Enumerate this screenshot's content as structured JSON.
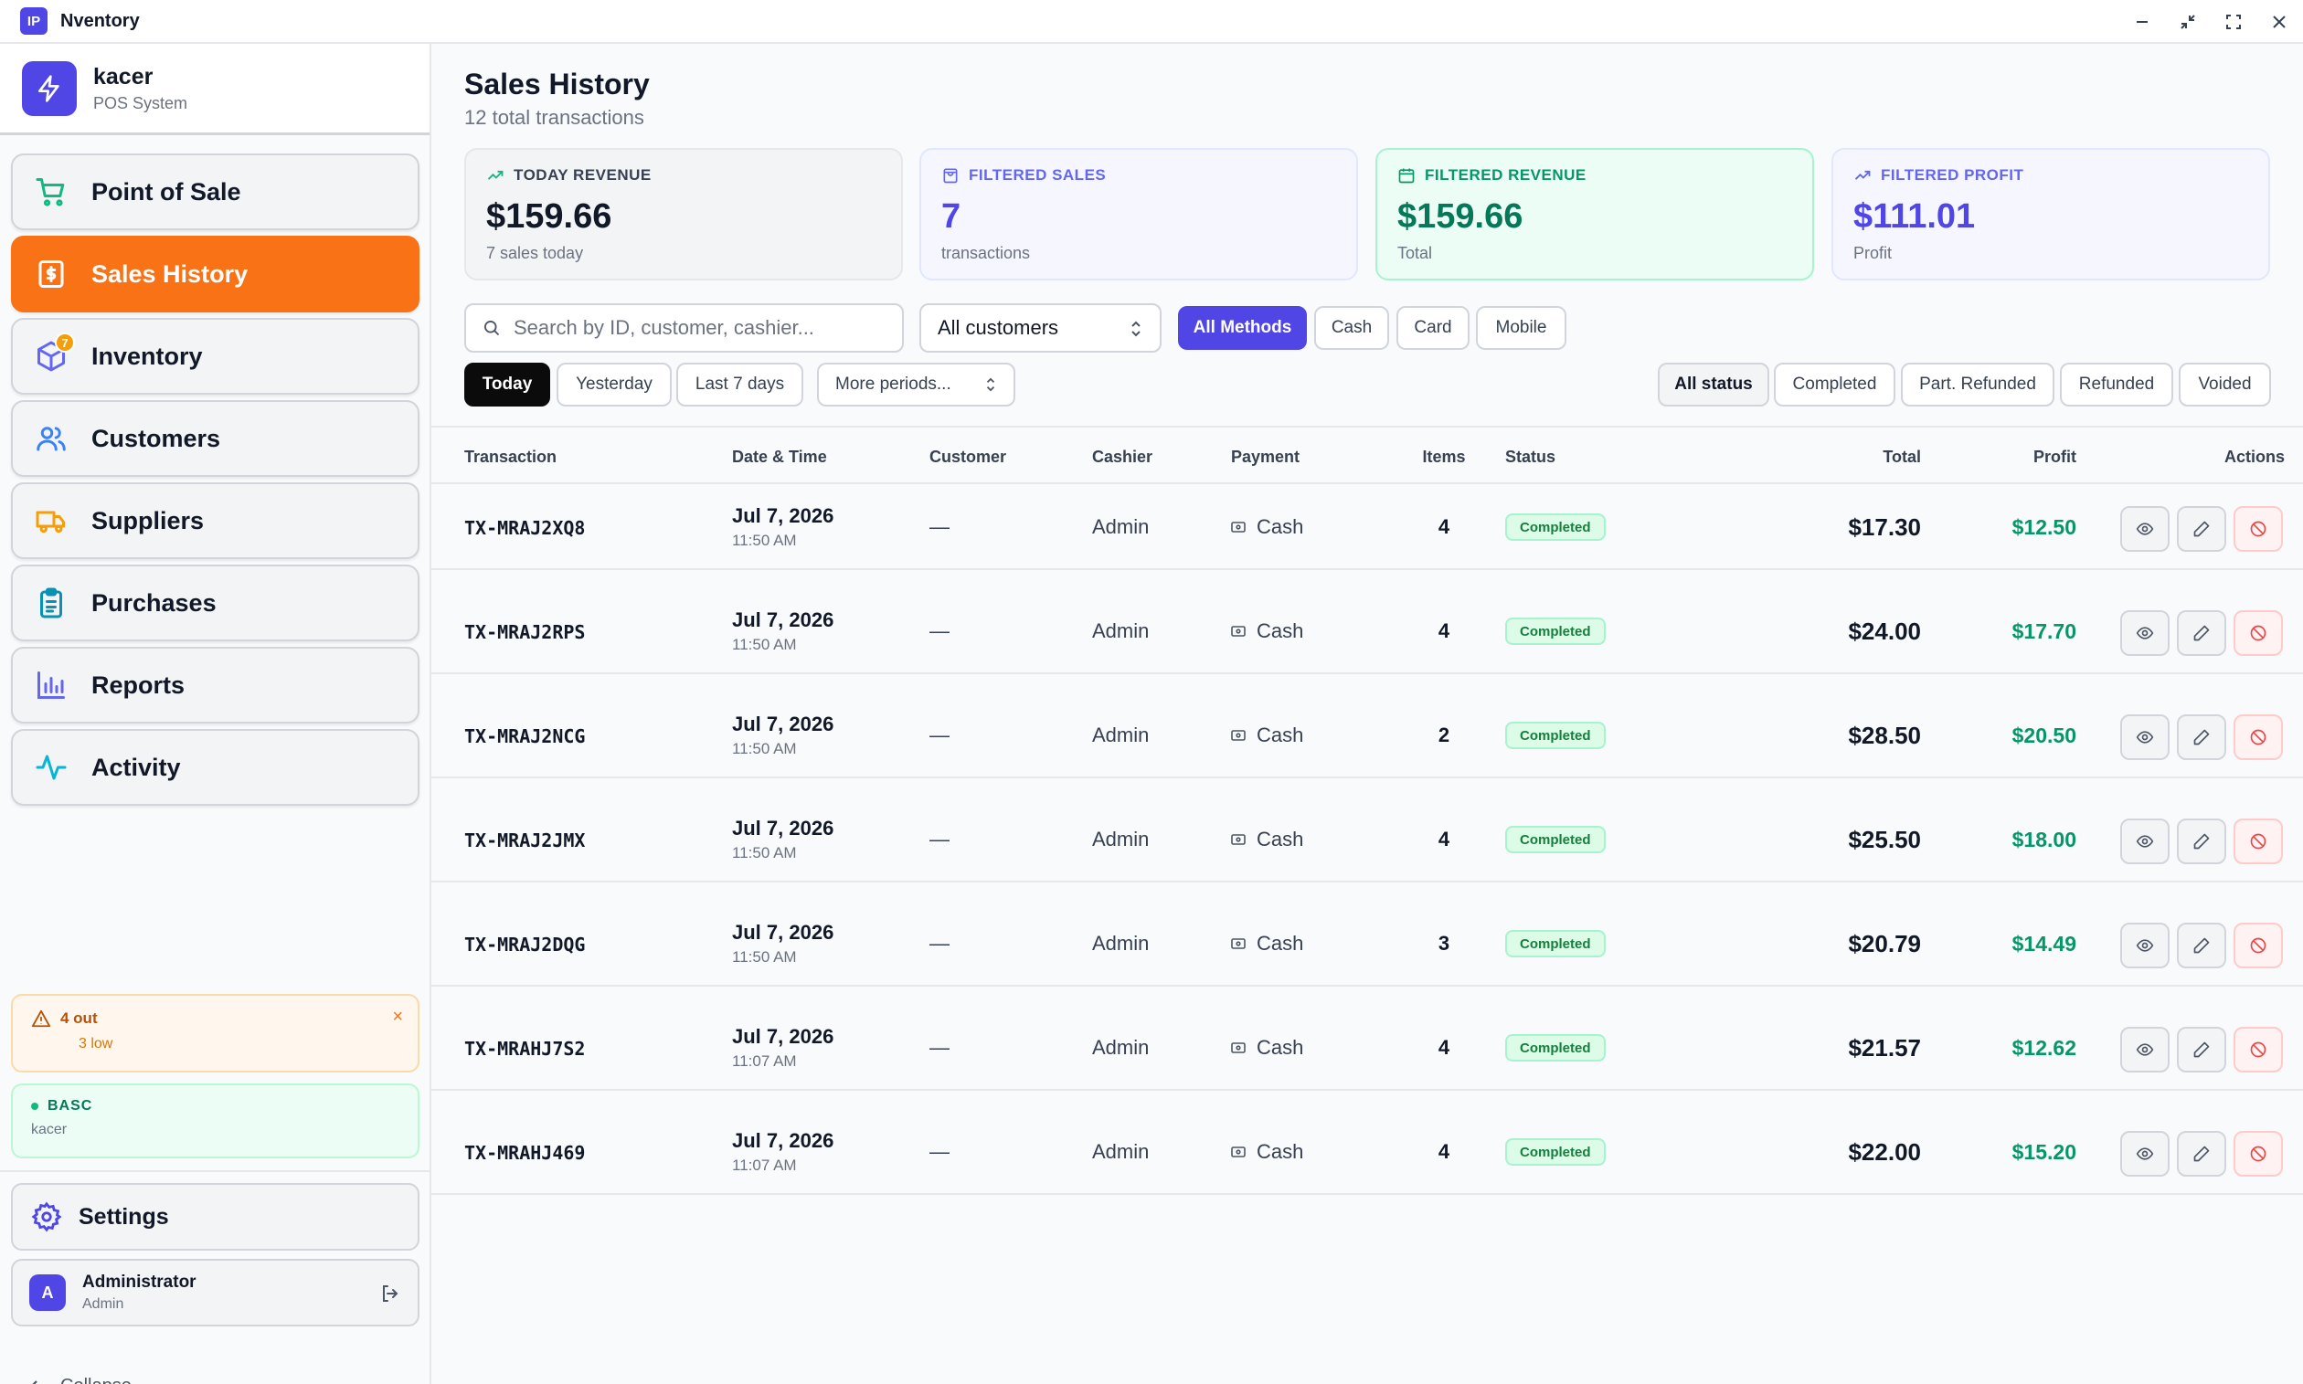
{
  "window": {
    "logo_text": "IP",
    "title": "Nventory"
  },
  "brand": {
    "name": "kacer",
    "subtitle": "POS System"
  },
  "nav": {
    "items": [
      {
        "label": "Point of Sale",
        "icon": "cart-icon"
      },
      {
        "label": "Sales History",
        "icon": "receipt-icon",
        "active": true
      },
      {
        "label": "Inventory",
        "icon": "box-icon",
        "badge": "7"
      },
      {
        "label": "Customers",
        "icon": "users-icon"
      },
      {
        "label": "Suppliers",
        "icon": "truck-icon"
      },
      {
        "label": "Purchases",
        "icon": "clipboard-icon"
      },
      {
        "label": "Reports",
        "icon": "bar-chart-icon"
      },
      {
        "label": "Activity",
        "icon": "activity-icon"
      }
    ]
  },
  "stock_alert": {
    "title": "4 out",
    "subtitle": "3 low",
    "close": "×"
  },
  "plan": {
    "title": "BASC",
    "subtitle": "kacer"
  },
  "settings": {
    "label": "Settings"
  },
  "user": {
    "initial": "A",
    "name": "Administrator",
    "role": "Admin"
  },
  "collapse": {
    "label": "Collapse"
  },
  "page": {
    "title": "Sales History",
    "subtitle": "12 total transactions"
  },
  "stats": [
    {
      "label": "TODAY REVENUE",
      "value": "$159.66",
      "sub": "7 sales today"
    },
    {
      "label": "FILTERED SALES",
      "value": "7",
      "sub": "transactions"
    },
    {
      "label": "FILTERED REVENUE",
      "value": "$159.66",
      "sub": "Total"
    },
    {
      "label": "FILTERED PROFIT",
      "value": "$111.01",
      "sub": "Profit"
    }
  ],
  "filters": {
    "search_placeholder": "Search by ID, customer, cashier...",
    "customer_select": "All customers",
    "methods": [
      "All Methods",
      "Cash",
      "Card",
      "Mobile"
    ],
    "periods": [
      "Today",
      "Yesterday",
      "Last 7 days"
    ],
    "more_periods": "More periods...",
    "statuses": [
      "All status",
      "Completed",
      "Part. Refunded",
      "Refunded",
      "Voided"
    ]
  },
  "table": {
    "headers": [
      "Transaction",
      "Date & Time",
      "Customer",
      "Cashier",
      "Payment",
      "Items",
      "Status",
      "Total",
      "Profit",
      "Actions"
    ],
    "rows": [
      {
        "id": "TX-MRAJ2XQ8",
        "date": "Jul 7, 2026",
        "time": "11:50 AM",
        "customer": "—",
        "cashier": "Admin",
        "payment": "Cash",
        "items": "4",
        "status": "Completed",
        "total": "$17.30",
        "profit": "$12.50"
      },
      {
        "id": "TX-MRAJ2RPS",
        "date": "Jul 7, 2026",
        "time": "11:50 AM",
        "customer": "—",
        "cashier": "Admin",
        "payment": "Cash",
        "items": "4",
        "status": "Completed",
        "total": "$24.00",
        "profit": "$17.70"
      },
      {
        "id": "TX-MRAJ2NCG",
        "date": "Jul 7, 2026",
        "time": "11:50 AM",
        "customer": "—",
        "cashier": "Admin",
        "payment": "Cash",
        "items": "2",
        "status": "Completed",
        "total": "$28.50",
        "profit": "$20.50"
      },
      {
        "id": "TX-MRAJ2JMX",
        "date": "Jul 7, 2026",
        "time": "11:50 AM",
        "customer": "—",
        "cashier": "Admin",
        "payment": "Cash",
        "items": "4",
        "status": "Completed",
        "total": "$25.50",
        "profit": "$18.00"
      },
      {
        "id": "TX-MRAJ2DQG",
        "date": "Jul 7, 2026",
        "time": "11:50 AM",
        "customer": "—",
        "cashier": "Admin",
        "payment": "Cash",
        "items": "3",
        "status": "Completed",
        "total": "$20.79",
        "profit": "$14.49"
      },
      {
        "id": "TX-MRAHJ7S2",
        "date": "Jul 7, 2026",
        "time": "11:07 AM",
        "customer": "—",
        "cashier": "Admin",
        "payment": "Cash",
        "items": "4",
        "status": "Completed",
        "total": "$21.57",
        "profit": "$12.62"
      },
      {
        "id": "TX-MRAHJ469",
        "date": "Jul 7, 2026",
        "time": "11:07 AM",
        "customer": "—",
        "cashier": "Admin",
        "payment": "Cash",
        "items": "4",
        "status": "Completed",
        "total": "$22.00",
        "profit": "$15.20"
      }
    ]
  },
  "colors": {
    "accent": "#4f46e5",
    "active_nav": "#f97316",
    "success": "#059669"
  }
}
